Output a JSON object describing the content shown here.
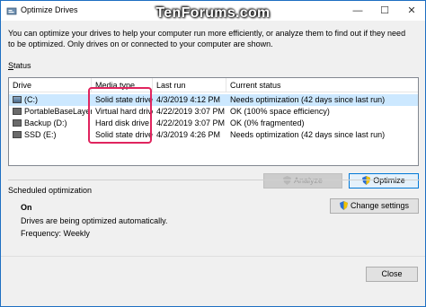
{
  "window": {
    "title": "Optimize Drives",
    "watermark": "TenForums.com",
    "min": "—",
    "max": "☐",
    "close": "✕"
  },
  "intro": "You can optimize your drives to help your computer run more efficiently, or analyze them to find out if they need to be optimized. Only drives on or connected to your computer are shown.",
  "status": {
    "label_prefix": "S",
    "label_rest": "tatus"
  },
  "columns": [
    "Drive",
    "Media type",
    "Last run",
    "Current status"
  ],
  "drives": [
    {
      "drive": "(C:)",
      "media": "Solid state drive",
      "last_run": "4/3/2019 4:12 PM",
      "status": "Needs optimization (42 days since last run)",
      "selected": true,
      "icon": "system-drive-icon"
    },
    {
      "drive": "PortableBaseLayer",
      "media": "Virtual hard drive",
      "last_run": "4/22/2019 3:07 PM",
      "status": "OK (100% space efficiency)",
      "selected": false,
      "icon": "drive-icon"
    },
    {
      "drive": "Backup (D:)",
      "media": "Hard disk drive",
      "last_run": "4/22/2019 3:07 PM",
      "status": "OK (0% fragmented)",
      "selected": false,
      "icon": "drive-icon"
    },
    {
      "drive": "SSD (E:)",
      "media": "Solid state drive",
      "last_run": "4/3/2019 4:26 PM",
      "status": "Needs optimization (42 days since last run)",
      "selected": false,
      "icon": "drive-icon"
    }
  ],
  "buttons": {
    "analyze": "Analyze",
    "optimize": "Optimize",
    "change_settings": "Change settings",
    "close": "Close"
  },
  "scheduled": {
    "title": "Scheduled optimization",
    "state": "On",
    "description": "Drives are being optimized automatically.",
    "frequency": "Frequency: Weekly"
  },
  "colors": {
    "highlight": "#e0245e",
    "selection": "#cce8ff",
    "accent": "#0078d7"
  }
}
